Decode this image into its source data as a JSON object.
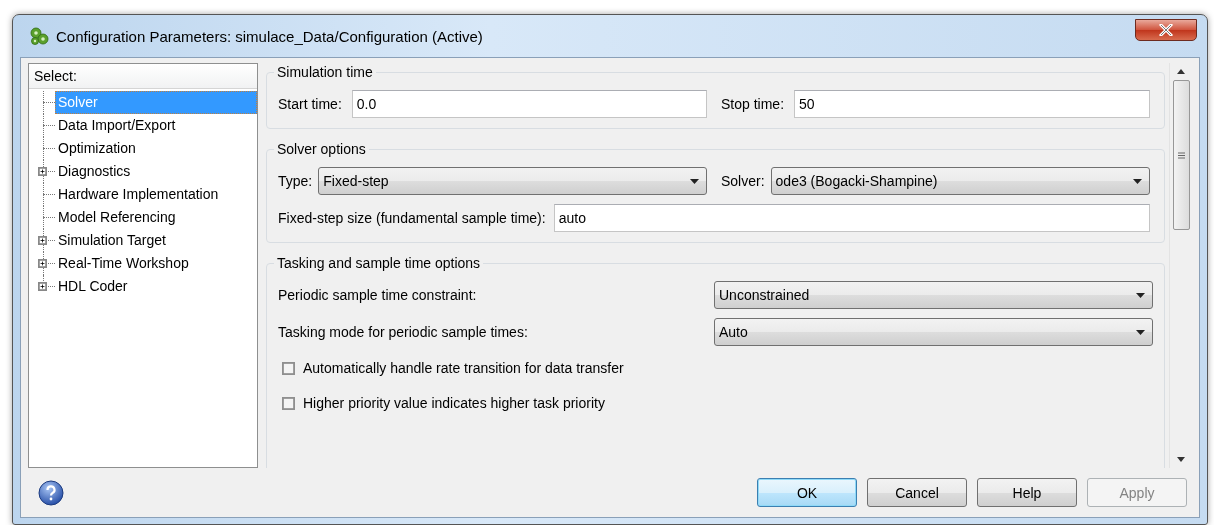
{
  "window": {
    "title": "Configuration Parameters: simulace_Data/Configuration (Active)"
  },
  "tree": {
    "header": "Select:",
    "items": [
      {
        "label": "Solver",
        "kind": "leaf",
        "selected": true
      },
      {
        "label": "Data Import/Export",
        "kind": "leaf",
        "selected": false
      },
      {
        "label": "Optimization",
        "kind": "leaf",
        "selected": false
      },
      {
        "label": "Diagnostics",
        "kind": "branch",
        "expanded": false,
        "selected": false
      },
      {
        "label": "Hardware Implementation",
        "kind": "leaf",
        "selected": false
      },
      {
        "label": "Model Referencing",
        "kind": "leaf",
        "selected": false
      },
      {
        "label": "Simulation Target",
        "kind": "branch",
        "expanded": false,
        "selected": false
      },
      {
        "label": "Real-Time Workshop",
        "kind": "branch",
        "expanded": false,
        "selected": false
      },
      {
        "label": "HDL Coder",
        "kind": "branch",
        "expanded": false,
        "selected": false
      }
    ]
  },
  "groups": [
    {
      "title": "Simulation time",
      "rows": [
        {
          "kind": "pair",
          "fields": [
            {
              "label": "Start time:",
              "kind": "text",
              "value": "0.0"
            },
            {
              "label": "Stop time:",
              "kind": "text",
              "value": "50"
            }
          ]
        }
      ]
    },
    {
      "title": "Solver options",
      "rows": [
        {
          "kind": "pair",
          "fields": [
            {
              "label": "Type:",
              "kind": "select",
              "value": "Fixed-step"
            },
            {
              "label": "Solver:",
              "kind": "select",
              "value": "ode3 (Bogacki-Shampine)"
            }
          ]
        },
        {
          "kind": "single",
          "fields": [
            {
              "label": "Fixed-step size (fundamental sample time):",
              "kind": "text",
              "value": "auto"
            }
          ]
        }
      ]
    },
    {
      "title": "Tasking and sample time options",
      "rows": [
        {
          "kind": "split",
          "fields": [
            {
              "label": "Periodic sample time constraint:",
              "kind": "select",
              "value": "Unconstrained"
            }
          ]
        },
        {
          "kind": "split",
          "fields": [
            {
              "label": "Tasking mode for periodic sample times:",
              "kind": "select",
              "value": "Auto"
            }
          ]
        },
        {
          "kind": "check",
          "label": "Automatically handle rate transition for data transfer",
          "checked": false
        },
        {
          "kind": "check",
          "label": "Higher priority value indicates higher task priority",
          "checked": false
        }
      ]
    }
  ],
  "buttons": [
    {
      "label": "OK",
      "default": true,
      "disabled": false
    },
    {
      "label": "Cancel",
      "default": false,
      "disabled": false
    },
    {
      "label": "Help",
      "default": false,
      "disabled": false
    },
    {
      "label": "Apply",
      "default": false,
      "disabled": true
    }
  ]
}
